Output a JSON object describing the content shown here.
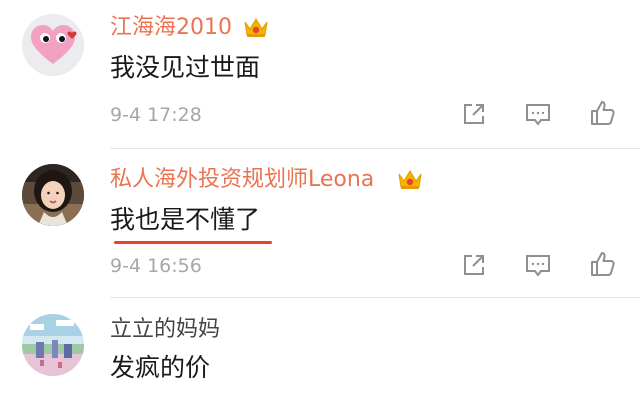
{
  "comments": [
    {
      "username": "江海海2010",
      "text": "我没见过世面",
      "time": "9-4 17:28",
      "vip": true,
      "avatar": "pink-heart-eyes-avatar"
    },
    {
      "username": "私人海外投资规划师Leona",
      "text": "我也是不懂了",
      "time": "9-4 16:56",
      "vip": true,
      "avatar": "woman-photo-avatar",
      "highlight": "red-underline"
    },
    {
      "username": "立立的妈妈",
      "text": "发疯的价",
      "vip": false,
      "avatar": "pixel-landscape-avatar"
    }
  ],
  "icons": {
    "share": "share-icon",
    "reply": "comment-icon",
    "like": "thumbs-up-icon",
    "vip": "crown-badge-icon"
  },
  "colors": {
    "username_vip": "#eb7350",
    "username_plain": "#444444",
    "text": "#1a1a1a",
    "meta": "#a7a7a7",
    "highlight": "#e8412c",
    "divider": "#e6e6e6"
  }
}
